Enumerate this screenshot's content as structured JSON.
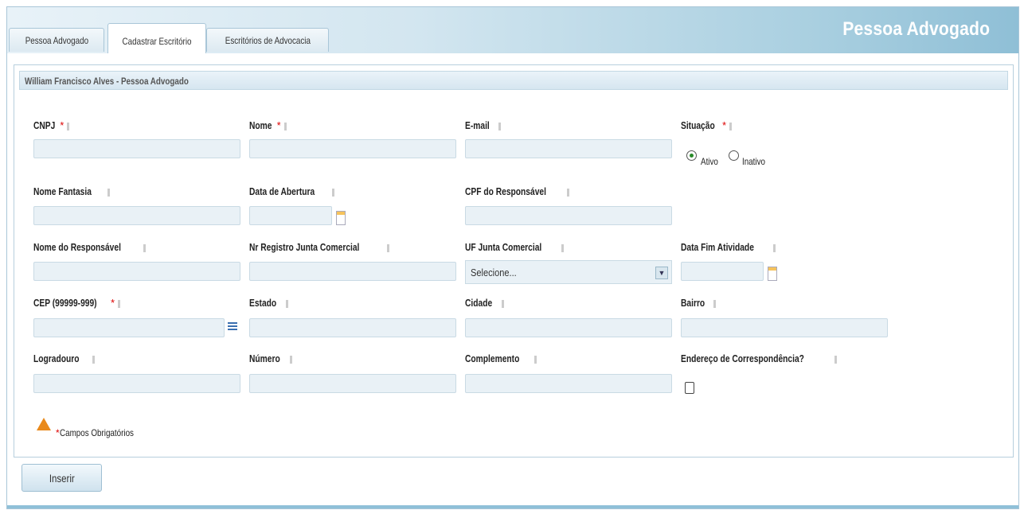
{
  "app": {
    "title": "Pessoa Advogado"
  },
  "tabs": [
    {
      "label": "Pessoa Advogado"
    },
    {
      "label": "Cadastrar Escritório"
    },
    {
      "label": "Escritórios de Advocacia"
    }
  ],
  "panel": {
    "header": "William Francisco Alves - Pessoa Advogado"
  },
  "required_mark": "*",
  "fields": {
    "cnpj": {
      "label": "CNPJ"
    },
    "nome": {
      "label": "Nome"
    },
    "email": {
      "label": "E-mail"
    },
    "situacao": {
      "label": "Situação",
      "options": [
        "Ativo",
        "Inativo"
      ],
      "selected": "Ativo"
    },
    "nome_fantasia": {
      "label": "Nome Fantasia"
    },
    "data_abertura": {
      "label": "Data de Abertura"
    },
    "cpf_responsavel": {
      "label": "CPF do Responsável"
    },
    "nome_responsavel": {
      "label": "Nome do Responsável"
    },
    "nr_registro": {
      "label": "Nr Registro Junta Comercial"
    },
    "uf_junta": {
      "label": "UF Junta Comercial",
      "value": "Selecione..."
    },
    "data_fim": {
      "label": "Data Fim Atividade"
    },
    "cep": {
      "label": "CEP (99999-999)"
    },
    "estado": {
      "label": "Estado"
    },
    "cidade": {
      "label": "Cidade"
    },
    "bairro": {
      "label": "Bairro"
    },
    "logradouro": {
      "label": "Logradouro"
    },
    "numero": {
      "label": "Número"
    },
    "complemento": {
      "label": "Complemento"
    },
    "endereco_corresp": {
      "label": "Endereço de Correspondência?"
    }
  },
  "footer_note": "Campos Obrigatórios",
  "actions": {
    "insert_label": "Inserir"
  },
  "colors": {
    "accent": "#8fbfd6",
    "input_bg": "#e9f1f6",
    "required": "#dd0000",
    "warning": "#e98a1c"
  }
}
